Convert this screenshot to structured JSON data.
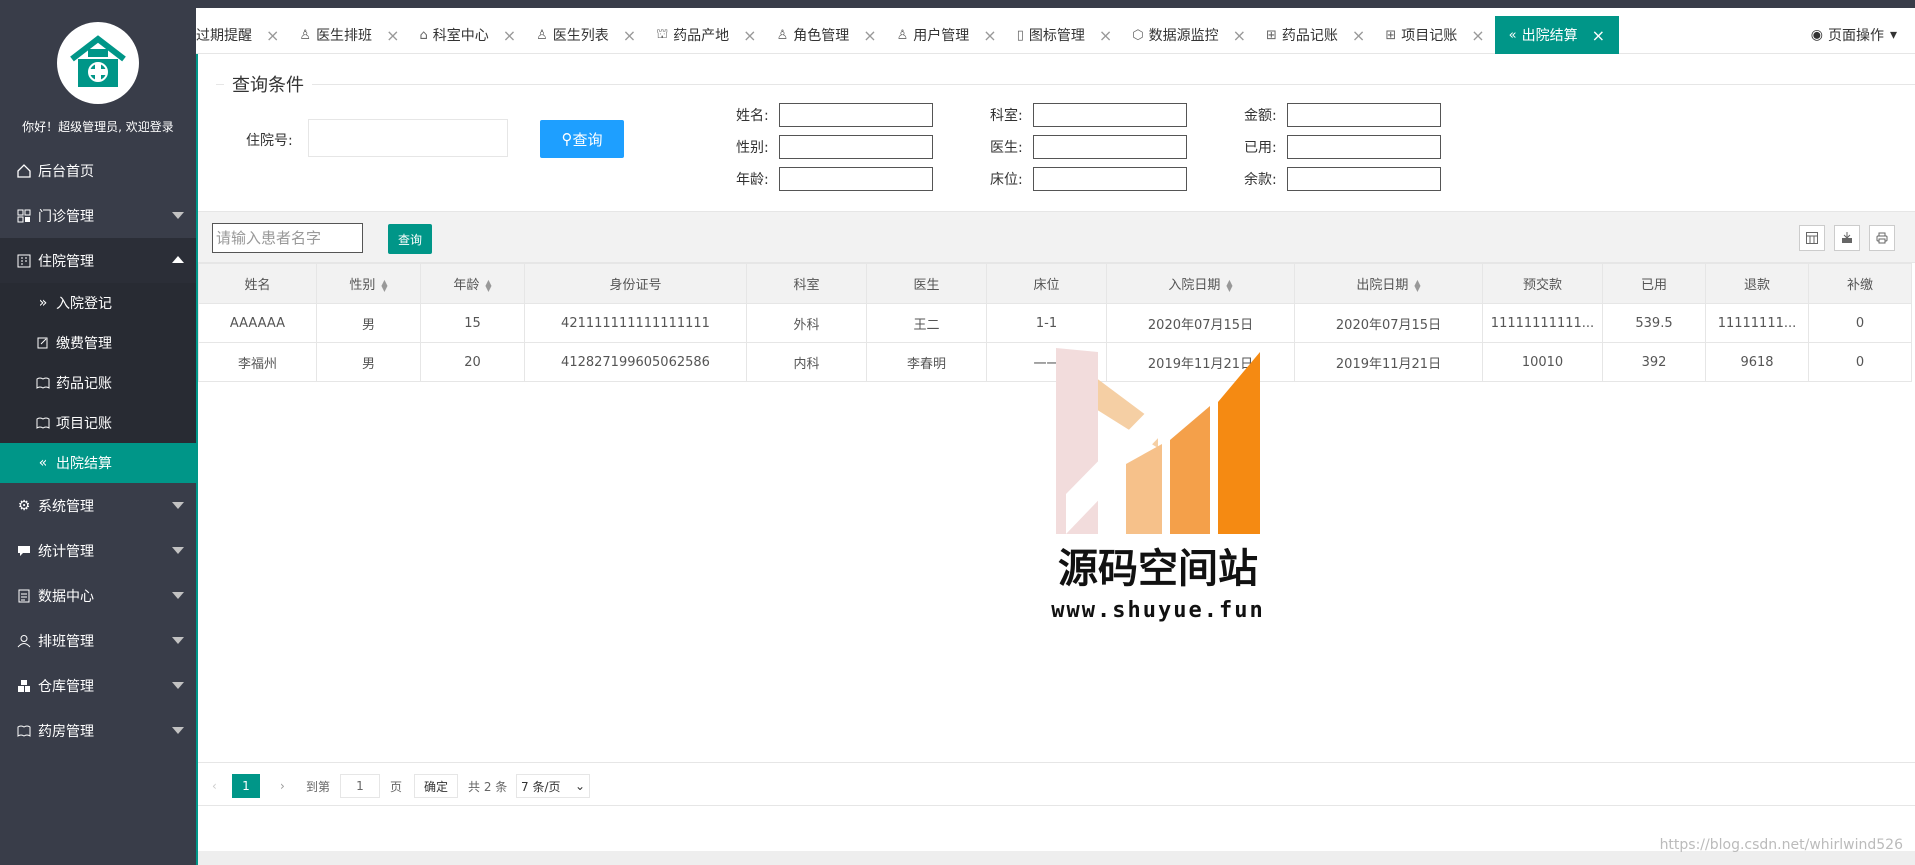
{
  "sidebar": {
    "welcome": "你好！超级管理员, 欢迎登录",
    "items": [
      {
        "label": "后台首页"
      },
      {
        "label": "门诊管理"
      },
      {
        "label": "住院管理"
      },
      {
        "label": "系统管理"
      },
      {
        "label": "统计管理"
      },
      {
        "label": "数据中心"
      },
      {
        "label": "排班管理"
      },
      {
        "label": "仓库管理"
      },
      {
        "label": "药房管理"
      }
    ],
    "sub_items": [
      {
        "label": "入院登记"
      },
      {
        "label": "缴费管理"
      },
      {
        "label": "药品记账"
      },
      {
        "label": "项目记账"
      },
      {
        "label": "出院结算"
      }
    ]
  },
  "tabs": [
    {
      "label": "过期提醒"
    },
    {
      "label": "医生排班"
    },
    {
      "label": "科室中心"
    },
    {
      "label": "医生列表"
    },
    {
      "label": "药品产地"
    },
    {
      "label": "角色管理"
    },
    {
      "label": "用户管理"
    },
    {
      "label": "图标管理"
    },
    {
      "label": "数据源监控"
    },
    {
      "label": "药品记账"
    },
    {
      "label": "项目记账"
    },
    {
      "label": "出院结算"
    }
  ],
  "page_ops": "页面操作",
  "query": {
    "legend": "查询条件",
    "admission_label": "住院号:",
    "query_button": "查询",
    "fields": {
      "name": "姓名:",
      "dept": "科室:",
      "amount": "金额:",
      "gender": "性别:",
      "doctor": "医生:",
      "used": "已用:",
      "age": "年龄:",
      "bed": "床位:",
      "balance": "余款:"
    }
  },
  "toolbar": {
    "search_placeholder": "请输入患者名字",
    "search_button": "查询"
  },
  "table": {
    "headers": [
      "姓名",
      "性别",
      "年龄",
      "身份证号",
      "科室",
      "医生",
      "床位",
      "入院日期",
      "出院日期",
      "预交款",
      "已用",
      "退款",
      "补缴"
    ],
    "rows": [
      [
        "AAAAAA",
        "男",
        "15",
        "421111111111111111",
        "外科",
        "王二",
        "1-1",
        "2020年07月15日",
        "2020年07月15日",
        "11111111111...",
        "539.5",
        "11111111...",
        "0"
      ],
      [
        "李福州",
        "男",
        "20",
        "412827199605062586",
        "内科",
        "李春明",
        "一一",
        "2019年11月21日",
        "2019年11月21日",
        "10010",
        "392",
        "9618",
        "0"
      ]
    ]
  },
  "pager": {
    "current": "1",
    "goto": "到第",
    "page_input": "1",
    "page_unit": "页",
    "confirm": "确定",
    "total": "共 2 条",
    "per_page": "7 条/页"
  },
  "watermark": {
    "title": "源码空间站",
    "url": "www.shuyue.fun"
  },
  "csdn_watermark": "https://blog.csdn.net/whirlwind526",
  "colors": {
    "accent": "#009688",
    "sidebar": "#393d49",
    "primary_button": "#1e9fff"
  }
}
